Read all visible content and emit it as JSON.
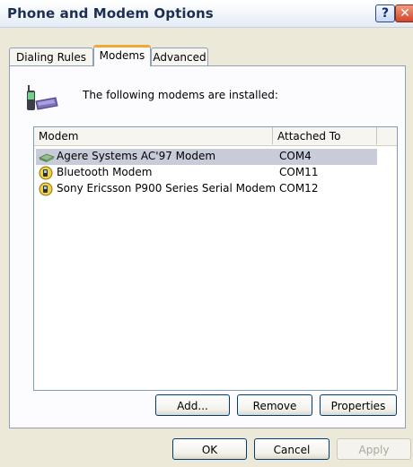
{
  "window": {
    "title": "Phone and Modem Options"
  },
  "titlebar_buttons": {
    "help": "?",
    "close": "✕"
  },
  "tabs": [
    {
      "label": "Dialing Rules"
    },
    {
      "label": "Modems"
    },
    {
      "label": "Advanced"
    }
  ],
  "modems_panel": {
    "caption": "The following modems are  installed:",
    "columns": {
      "modem": "Modem",
      "attached_to": "Attached To"
    },
    "rows": [
      {
        "name": "Agere Systems AC'97 Modem",
        "port": "COM4",
        "icon": "modem-icon",
        "selected": true
      },
      {
        "name": "Bluetooth Modem",
        "port": "COM11",
        "icon": "phone-modem-icon",
        "selected": false
      },
      {
        "name": "Sony Ericsson P900 Series Serial Modem",
        "port": "COM12",
        "icon": "phone-modem-icon",
        "selected": false
      }
    ],
    "buttons": {
      "add": "Add...",
      "remove": "Remove",
      "properties": "Properties"
    }
  },
  "dialog_buttons": {
    "ok": "OK",
    "cancel": "Cancel",
    "apply": "Apply"
  },
  "colors": {
    "dialog_bg": "#ece9d8",
    "selection": "#c8ccd8",
    "tab_highlight": "#f2a73a"
  }
}
